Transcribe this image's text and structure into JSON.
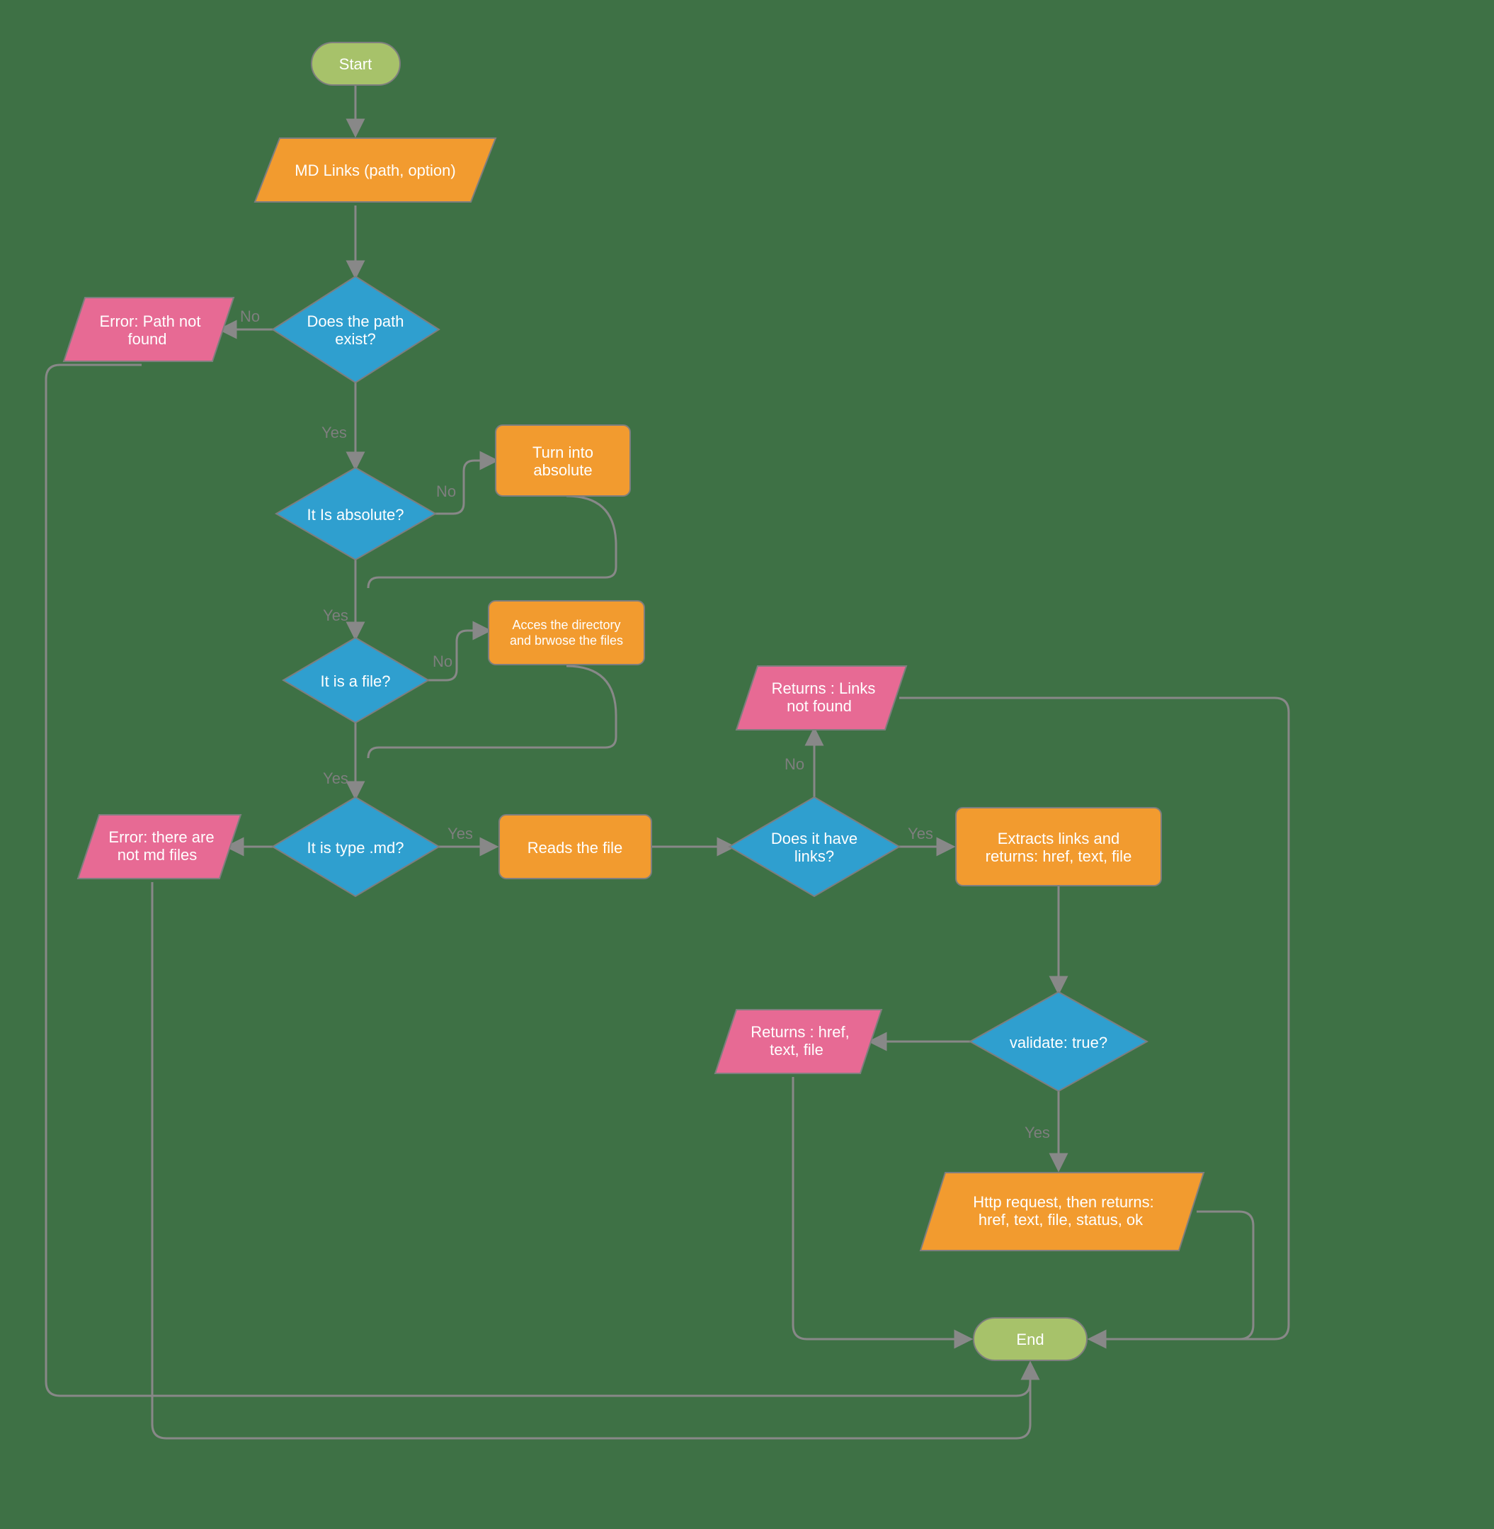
{
  "nodes": {
    "start": "Start",
    "mdlinks": "MD Links (path, option)",
    "pathExist": "Does the path exist?",
    "errPath1": "Error: Path not",
    "errPath2": "found",
    "isAbsolute": "It Is absolute?",
    "turnAbs1": "Turn into",
    "turnAbs2": "absolute",
    "isFile": "It is a file?",
    "accessDir1": "Acces the directory",
    "accessDir2": "and  brwose the files",
    "isMd": "It is type .md?",
    "errMd1": "Error: there are",
    "errMd2": "not md files",
    "readsFile": "Reads the file",
    "hasLinks1": "Does it have",
    "hasLinks2": "links?",
    "linksNF1": "Returns : Links",
    "linksNF2": "not found",
    "extract1": "Extracts links and",
    "extract2": "returns: href, text, file",
    "validate": "validate: true?",
    "retHTF1": "Returns : href,",
    "retHTF2": "text, file",
    "http1": "Http request, then returns:",
    "http2": "href, text, file, status, ok",
    "end": "End"
  },
  "labels": {
    "yes": "Yes",
    "no": "No"
  }
}
